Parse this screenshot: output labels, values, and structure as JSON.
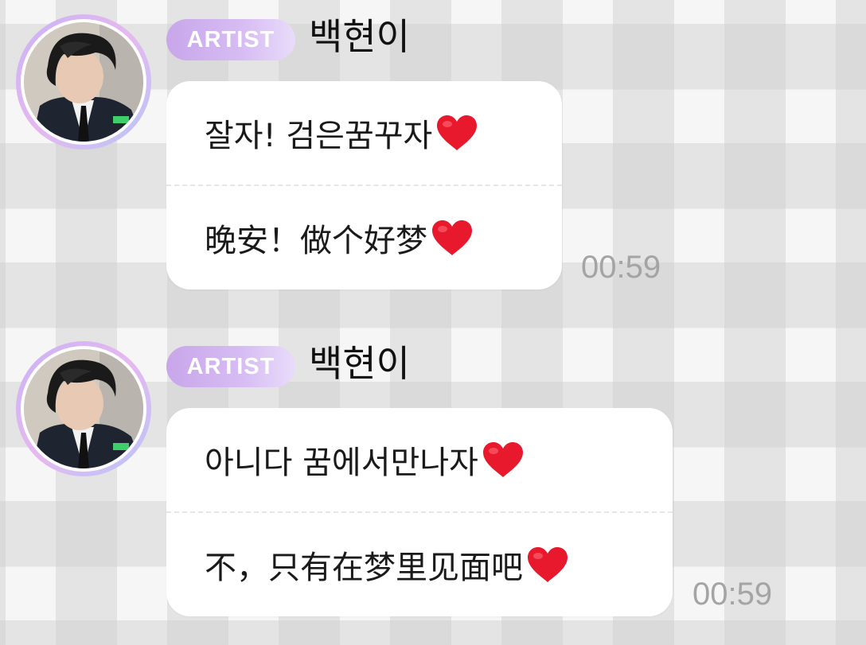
{
  "messages": [
    {
      "badge": "ARTIST",
      "name": "백현이",
      "lines": [
        "잘자! 검은꿈꾸자",
        "晚安！做个好梦"
      ],
      "time": "00:59"
    },
    {
      "badge": "ARTIST",
      "name": "백현이",
      "lines": [
        "아니다 꿈에서만나자",
        "不，只有在梦里见面吧"
      ],
      "time": "00:59"
    }
  ],
  "icons": {
    "avatar": "avatar-photo",
    "line_end": "red-heart-emoji"
  },
  "colors": {
    "badge_gradient_start": "#c8a6ea",
    "heart": "#e8192c",
    "timestamp": "#a4a4a4"
  }
}
